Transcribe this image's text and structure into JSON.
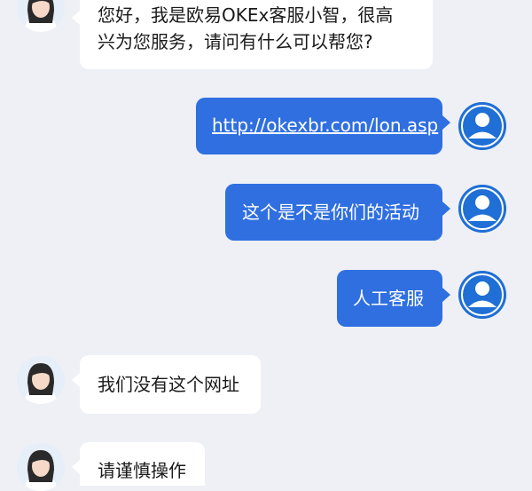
{
  "colors": {
    "background": "#eef0f5",
    "agent_bubble": "#ffffff",
    "user_bubble": "#2f6fe0",
    "agent_text": "#1a1a1a",
    "user_text": "#ffffff",
    "user_avatar": "#1f6fd6"
  },
  "messages": [
    {
      "sender": "agent",
      "avatar_icon": "agent-portrait-icon",
      "lines": [
        "您好，我是欧易OKEx客服小智，很高",
        "兴为您服务，请问有什么可以帮您?"
      ]
    },
    {
      "sender": "user",
      "avatar_icon": "user-silhouette-icon",
      "text": "http://okexbr.com/lon.asp",
      "is_link": true
    },
    {
      "sender": "user",
      "avatar_icon": "user-silhouette-icon",
      "text": "这个是不是你们的活动"
    },
    {
      "sender": "user",
      "avatar_icon": "user-silhouette-icon",
      "text": "人工客服"
    },
    {
      "sender": "agent",
      "avatar_icon": "agent-portrait-icon",
      "text": "我们没有这个网址"
    },
    {
      "sender": "agent",
      "avatar_icon": "agent-portrait-icon",
      "text": "请谨慎操作"
    }
  ]
}
